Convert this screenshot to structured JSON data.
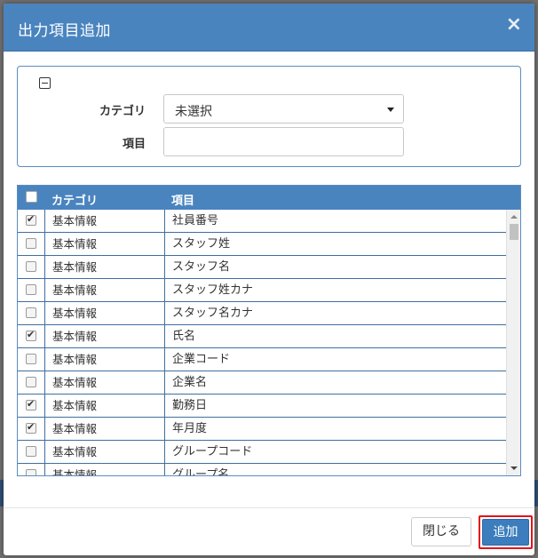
{
  "dialog": {
    "title": "出力項目追加",
    "close_symbol": "×"
  },
  "search": {
    "category_label": "カテゴリ",
    "category_value": "未選択",
    "item_label": "項目",
    "item_value": ""
  },
  "grid": {
    "headers": {
      "category": "カテゴリ",
      "item": "項目"
    },
    "rows": [
      {
        "checked": true,
        "category": "基本情報",
        "item": "社員番号"
      },
      {
        "checked": false,
        "category": "基本情報",
        "item": "スタッフ姓"
      },
      {
        "checked": false,
        "category": "基本情報",
        "item": "スタッフ名"
      },
      {
        "checked": false,
        "category": "基本情報",
        "item": "スタッフ姓カナ"
      },
      {
        "checked": false,
        "category": "基本情報",
        "item": "スタッフ名カナ"
      },
      {
        "checked": true,
        "category": "基本情報",
        "item": "氏名"
      },
      {
        "checked": false,
        "category": "基本情報",
        "item": "企業コード"
      },
      {
        "checked": false,
        "category": "基本情報",
        "item": "企業名"
      },
      {
        "checked": true,
        "category": "基本情報",
        "item": "勤務日"
      },
      {
        "checked": true,
        "category": "基本情報",
        "item": "年月度"
      },
      {
        "checked": false,
        "category": "基本情報",
        "item": "グループコード"
      },
      {
        "checked": false,
        "category": "基本情報",
        "item": "グループ名"
      }
    ]
  },
  "footer": {
    "close_label": "閉じる",
    "add_label": "追加"
  },
  "colors": {
    "header_blue": "#4a84bf",
    "add_button_blue": "#3c7dbd",
    "highlight_red": "#e0151a"
  }
}
